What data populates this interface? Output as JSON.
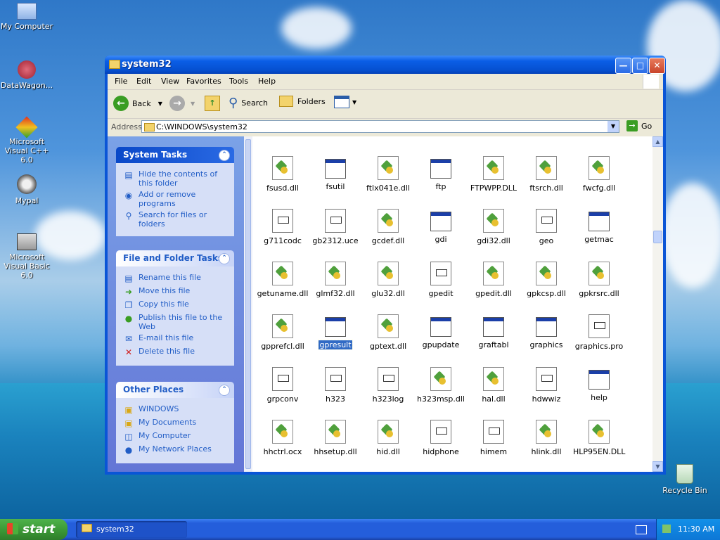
{
  "desktop": {
    "icons": [
      {
        "label": "My Computer"
      },
      {
        "label": "DataWagon..."
      },
      {
        "label": "Microsoft Visual C++ 6.0"
      },
      {
        "label": "Mypal"
      },
      {
        "label": "Microsoft Visual Basic 6.0"
      },
      {
        "label": "Recycle Bin"
      }
    ]
  },
  "window": {
    "title": "system32",
    "menu": [
      "File",
      "Edit",
      "View",
      "Favorites",
      "Tools",
      "Help"
    ],
    "toolbar": {
      "back": "Back",
      "search": "Search",
      "folders": "Folders"
    },
    "address": {
      "label": "Address",
      "value": "C:\\WINDOWS\\system32",
      "go": "Go"
    }
  },
  "tasks": {
    "system": {
      "title": "System Tasks",
      "items": [
        "Hide the contents of this folder",
        "Add or remove programs",
        "Search for files or folders"
      ]
    },
    "file_folder": {
      "title": "File and Folder Tasks",
      "items": [
        "Rename this file",
        "Move this file",
        "Copy this file",
        "Publish this file to the Web",
        "E-mail this file",
        "Delete this file"
      ]
    },
    "other": {
      "title": "Other Places",
      "items": [
        "WINDOWS",
        "My Documents",
        "My Computer",
        "My Network Places"
      ]
    }
  },
  "files": [
    {
      "name": "fsusd.dll",
      "type": "dll"
    },
    {
      "name": "fsutil",
      "type": "exe"
    },
    {
      "name": "ftlx041e.dll",
      "type": "dll"
    },
    {
      "name": "ftp",
      "type": "exe"
    },
    {
      "name": "FTPWPP.DLL",
      "type": "dll"
    },
    {
      "name": "ftsrch.dll",
      "type": "dll"
    },
    {
      "name": "fwcfg.dll",
      "type": "dll"
    },
    {
      "name": "g711codc",
      "type": "doc"
    },
    {
      "name": "gb2312.uce",
      "type": "doc"
    },
    {
      "name": "gcdef.dll",
      "type": "dll"
    },
    {
      "name": "gdi",
      "type": "exe"
    },
    {
      "name": "gdi32.dll",
      "type": "dll"
    },
    {
      "name": "geo",
      "type": "doc"
    },
    {
      "name": "getmac",
      "type": "exe"
    },
    {
      "name": "getuname.dll",
      "type": "dll"
    },
    {
      "name": "glmf32.dll",
      "type": "dll"
    },
    {
      "name": "glu32.dll",
      "type": "dll"
    },
    {
      "name": "gpedit",
      "type": "doc"
    },
    {
      "name": "gpedit.dll",
      "type": "dll"
    },
    {
      "name": "gpkcsp.dll",
      "type": "dll"
    },
    {
      "name": "gpkrsrc.dll",
      "type": "dll"
    },
    {
      "name": "gpprefcl.dll",
      "type": "dll"
    },
    {
      "name": "gpresult",
      "type": "exe",
      "selected": true
    },
    {
      "name": "gptext.dll",
      "type": "dll"
    },
    {
      "name": "gpupdate",
      "type": "exe"
    },
    {
      "name": "graftabl",
      "type": "exe"
    },
    {
      "name": "graphics",
      "type": "exe"
    },
    {
      "name": "graphics.pro",
      "type": "doc"
    },
    {
      "name": "grpconv",
      "type": "doc"
    },
    {
      "name": "h323",
      "type": "doc"
    },
    {
      "name": "h323log",
      "type": "doc"
    },
    {
      "name": "h323msp.dll",
      "type": "dll"
    },
    {
      "name": "hal.dll",
      "type": "dll"
    },
    {
      "name": "hdwwiz",
      "type": "doc"
    },
    {
      "name": "help",
      "type": "exe"
    },
    {
      "name": "hhctrl.ocx",
      "type": "dll"
    },
    {
      "name": "hhsetup.dll",
      "type": "dll"
    },
    {
      "name": "hid.dll",
      "type": "dll"
    },
    {
      "name": "hidphone",
      "type": "doc"
    },
    {
      "name": "himem",
      "type": "doc"
    },
    {
      "name": "hlink.dll",
      "type": "dll"
    },
    {
      "name": "HLP95EN.DLL",
      "type": "dll"
    }
  ],
  "taskbar": {
    "start": "start",
    "task": "system32",
    "time": "11:30 AM"
  }
}
